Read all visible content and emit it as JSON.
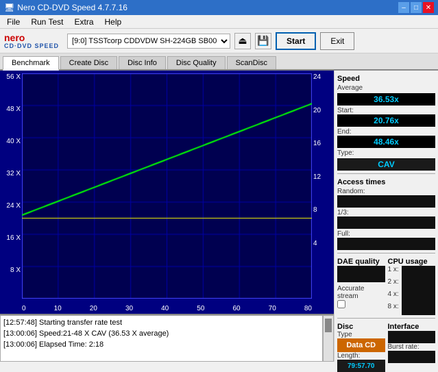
{
  "titleBar": {
    "title": "Nero CD-DVD Speed 4.7.7.16",
    "controls": [
      "–",
      "□",
      "✕"
    ]
  },
  "menuBar": {
    "items": [
      "File",
      "Run Test",
      "Extra",
      "Help"
    ]
  },
  "toolbar": {
    "logoLine1": "nero",
    "logoLine2": "CD·DVD SPEED",
    "driveLabel": "[9:0]  TSSTcorp CDDVDW SH-224GB SB00",
    "startLabel": "Start",
    "exitLabel": "Exit"
  },
  "tabs": {
    "items": [
      "Benchmark",
      "Create Disc",
      "Disc Info",
      "Disc Quality",
      "ScanDisc"
    ],
    "active": 0
  },
  "chartYLeft": [
    "56 X",
    "",
    "48 X",
    "",
    "40 X",
    "",
    "32 X",
    "",
    "24 X",
    "",
    "16 X",
    "",
    "8 X",
    ""
  ],
  "chartYRight": [
    "24",
    "",
    "20",
    "",
    "16",
    "",
    "12",
    "",
    "8",
    "",
    "4",
    "",
    ""
  ],
  "chartXBottom": [
    "0",
    "10",
    "20",
    "30",
    "40",
    "50",
    "60",
    "70",
    "80"
  ],
  "rightPanel": {
    "speedTitle": "Speed",
    "avgLabel": "Average",
    "avgValue": "36.53x",
    "startLabel": "Start:",
    "startValue": "20.76x",
    "endLabel": "End:",
    "endValue": "48.46x",
    "typeLabel": "Type:",
    "typeValue": "CAV",
    "accessTimesTitle": "Access times",
    "randomLabel": "Random:",
    "randomValue": "",
    "oneThirdLabel": "1/3:",
    "oneThirdValue": "",
    "fullLabel": "Full:",
    "fullValue": "",
    "daeTitle": "DAE quality",
    "daeValue": "",
    "accurateLabel": "Accurate",
    "streamLabel": "stream",
    "cpuTitle": "CPU usage",
    "cpu1xLabel": "1 x:",
    "cpu1xValue": "",
    "cpu2xLabel": "2 x:",
    "cpu2xValue": "",
    "cpu4xLabel": "4 x:",
    "cpu4xValue": "",
    "cpu8xLabel": "8 x:",
    "cpu8xValue": "",
    "discTitle": "Disc",
    "discTypeLabel": "Type",
    "discTypeValue": "Data CD",
    "interfaceLabel": "Interface",
    "burstLabel": "Burst rate:",
    "burstValue": "",
    "lengthLabel": "Length:",
    "lengthValue": "79:57.70"
  },
  "log": {
    "lines": [
      "[12:57:48]  Starting transfer rate test",
      "[13:00:06]  Speed:21-48 X CAV (36.53 X average)",
      "[13:00:06]  Elapsed Time: 2:18"
    ]
  }
}
